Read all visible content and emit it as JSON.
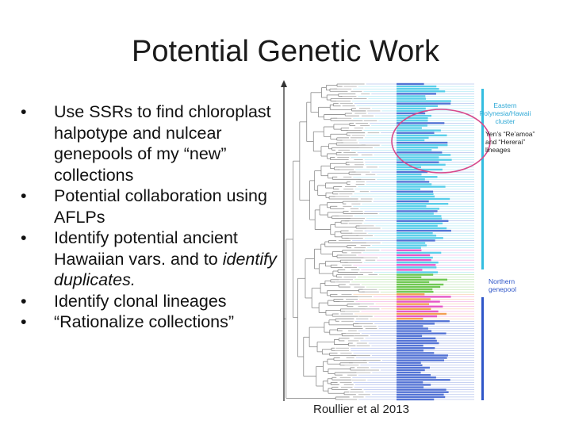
{
  "slide": {
    "title": "Potential Genetic Work",
    "bullets": [
      {
        "text": "Use SSRs to find chloroplast halpotype and nulcear genepools of my “new” collections",
        "italic_part": ""
      },
      {
        "text": "Potential collaboration using AFLPs",
        "italic_part": ""
      },
      {
        "text": "Identify potential ancient Hawaiian vars. and to ",
        "italic_part": "identify duplicates."
      },
      {
        "text": "Identify clonal lineages",
        "italic_part": ""
      },
      {
        "text": "“Rationalize collections”",
        "italic_part": ""
      }
    ],
    "bullet_char": "•",
    "figure": {
      "label_eastern_1": "Eastern",
      "label_eastern_2": "Polynesia/Hawaii",
      "label_eastern_3": "cluster",
      "label_yen_1": "Yen’s “Re’amoa”",
      "label_yen_2": "and “Hererai”",
      "label_yen_3": "lineages",
      "label_northern_1": "Northern",
      "label_northern_2": "genepool",
      "colors": {
        "cyan": "#3fc7e6",
        "blue": "#3b5fcf",
        "magenta": "#e040c0",
        "green": "#5bbf3a",
        "orange": "#f0903a",
        "circle": "#d64a8c",
        "eastern_bar": "#33bde0",
        "northern_bar": "#2f56c8",
        "eastern_text": "#2fa9d6",
        "northern_text": "#2f56c8"
      }
    },
    "caption": "Roullier et al 2013"
  }
}
